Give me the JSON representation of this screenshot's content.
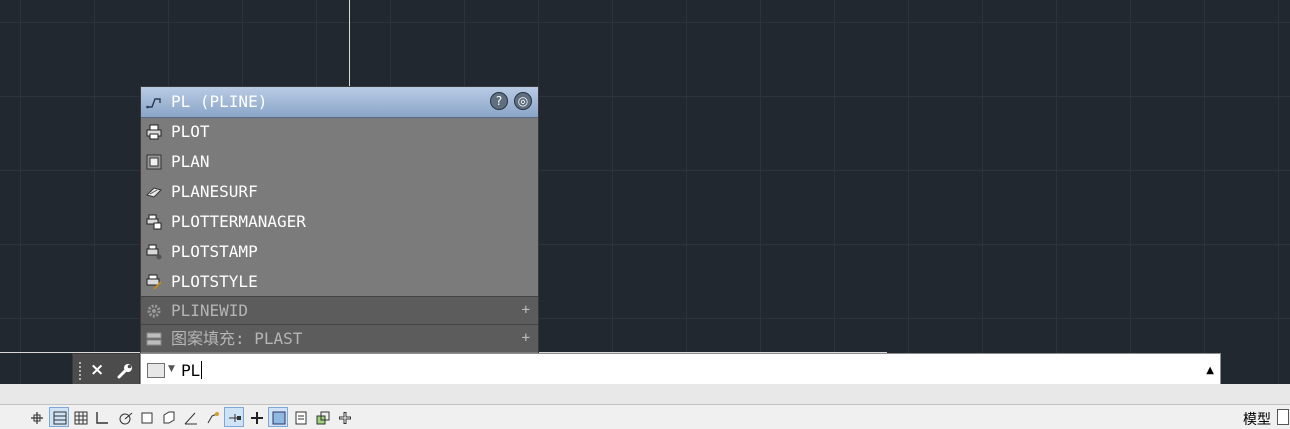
{
  "autocomplete": {
    "header": {
      "label": "PL (PLINE)",
      "help_icon": "help-icon",
      "web_icon": "globe-search-icon"
    },
    "items": [
      {
        "label": "PLOT",
        "icon": "printer-icon"
      },
      {
        "label": "PLAN",
        "icon": "plan-view-icon"
      },
      {
        "label": "PLANESURF",
        "icon": "plane-surface-icon"
      },
      {
        "label": "PLOTTERMANAGER",
        "icon": "plotter-manager-icon"
      },
      {
        "label": "PLOTSTAMP",
        "icon": "plot-stamp-icon"
      },
      {
        "label": "PLOTSTYLE",
        "icon": "plot-style-icon"
      }
    ],
    "sections": [
      {
        "label": "PLINEWID",
        "icon": "gear-icon",
        "expand": "+"
      },
      {
        "label": "图案填充: PLAST",
        "icon": "hatch-icon",
        "expand": "+"
      }
    ]
  },
  "command_line": {
    "close_icon": "×",
    "input_value": "PL",
    "expand_icon": "▲"
  },
  "statusbar": {
    "model_label": "模型",
    "buttons": [
      "snap-icon",
      "grid-display-icon",
      "grid-icon",
      "ortho-icon",
      "polar-icon",
      "osnap-icon",
      "3d-osnap-icon",
      "otrack-icon",
      "dynamic-ucs-icon",
      "dynamic-input-icon",
      "lineweight-icon",
      "transparency-icon",
      "quick-properties-icon",
      "selection-cycling-icon",
      "annotation-monitor-icon"
    ]
  }
}
